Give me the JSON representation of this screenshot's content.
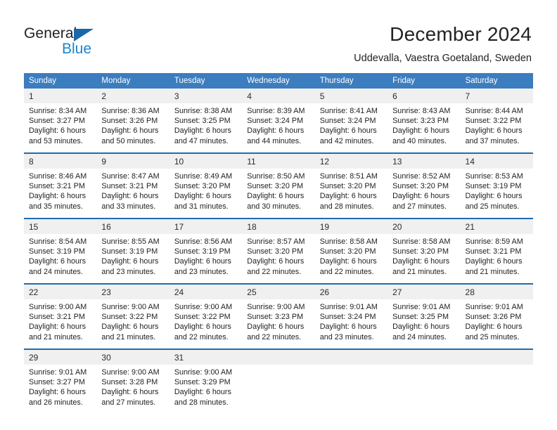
{
  "brand": {
    "name_part1": "General",
    "name_part2": "Blue",
    "triangle_color": "#1769ac",
    "blue_color": "#1b85d0"
  },
  "header": {
    "title": "December 2024",
    "subtitle": "Uddevalla, Vaestra Goetaland, Sweden",
    "header_bg": "#3b7dbf",
    "separator_color": "#1f6cb0",
    "daynum_bg": "#f0f0f0"
  },
  "weekday_headers": [
    "Sunday",
    "Monday",
    "Tuesday",
    "Wednesday",
    "Thursday",
    "Friday",
    "Saturday"
  ],
  "weeks": [
    {
      "days": [
        {
          "num": "1",
          "sunrise": "Sunrise: 8:34 AM",
          "sunset": "Sunset: 3:27 PM",
          "daylight1": "Daylight: 6 hours",
          "daylight2": "and 53 minutes."
        },
        {
          "num": "2",
          "sunrise": "Sunrise: 8:36 AM",
          "sunset": "Sunset: 3:26 PM",
          "daylight1": "Daylight: 6 hours",
          "daylight2": "and 50 minutes."
        },
        {
          "num": "3",
          "sunrise": "Sunrise: 8:38 AM",
          "sunset": "Sunset: 3:25 PM",
          "daylight1": "Daylight: 6 hours",
          "daylight2": "and 47 minutes."
        },
        {
          "num": "4",
          "sunrise": "Sunrise: 8:39 AM",
          "sunset": "Sunset: 3:24 PM",
          "daylight1": "Daylight: 6 hours",
          "daylight2": "and 44 minutes."
        },
        {
          "num": "5",
          "sunrise": "Sunrise: 8:41 AM",
          "sunset": "Sunset: 3:24 PM",
          "daylight1": "Daylight: 6 hours",
          "daylight2": "and 42 minutes."
        },
        {
          "num": "6",
          "sunrise": "Sunrise: 8:43 AM",
          "sunset": "Sunset: 3:23 PM",
          "daylight1": "Daylight: 6 hours",
          "daylight2": "and 40 minutes."
        },
        {
          "num": "7",
          "sunrise": "Sunrise: 8:44 AM",
          "sunset": "Sunset: 3:22 PM",
          "daylight1": "Daylight: 6 hours",
          "daylight2": "and 37 minutes."
        }
      ]
    },
    {
      "days": [
        {
          "num": "8",
          "sunrise": "Sunrise: 8:46 AM",
          "sunset": "Sunset: 3:21 PM",
          "daylight1": "Daylight: 6 hours",
          "daylight2": "and 35 minutes."
        },
        {
          "num": "9",
          "sunrise": "Sunrise: 8:47 AM",
          "sunset": "Sunset: 3:21 PM",
          "daylight1": "Daylight: 6 hours",
          "daylight2": "and 33 minutes."
        },
        {
          "num": "10",
          "sunrise": "Sunrise: 8:49 AM",
          "sunset": "Sunset: 3:20 PM",
          "daylight1": "Daylight: 6 hours",
          "daylight2": "and 31 minutes."
        },
        {
          "num": "11",
          "sunrise": "Sunrise: 8:50 AM",
          "sunset": "Sunset: 3:20 PM",
          "daylight1": "Daylight: 6 hours",
          "daylight2": "and 30 minutes."
        },
        {
          "num": "12",
          "sunrise": "Sunrise: 8:51 AM",
          "sunset": "Sunset: 3:20 PM",
          "daylight1": "Daylight: 6 hours",
          "daylight2": "and 28 minutes."
        },
        {
          "num": "13",
          "sunrise": "Sunrise: 8:52 AM",
          "sunset": "Sunset: 3:20 PM",
          "daylight1": "Daylight: 6 hours",
          "daylight2": "and 27 minutes."
        },
        {
          "num": "14",
          "sunrise": "Sunrise: 8:53 AM",
          "sunset": "Sunset: 3:19 PM",
          "daylight1": "Daylight: 6 hours",
          "daylight2": "and 25 minutes."
        }
      ]
    },
    {
      "days": [
        {
          "num": "15",
          "sunrise": "Sunrise: 8:54 AM",
          "sunset": "Sunset: 3:19 PM",
          "daylight1": "Daylight: 6 hours",
          "daylight2": "and 24 minutes."
        },
        {
          "num": "16",
          "sunrise": "Sunrise: 8:55 AM",
          "sunset": "Sunset: 3:19 PM",
          "daylight1": "Daylight: 6 hours",
          "daylight2": "and 23 minutes."
        },
        {
          "num": "17",
          "sunrise": "Sunrise: 8:56 AM",
          "sunset": "Sunset: 3:19 PM",
          "daylight1": "Daylight: 6 hours",
          "daylight2": "and 23 minutes."
        },
        {
          "num": "18",
          "sunrise": "Sunrise: 8:57 AM",
          "sunset": "Sunset: 3:20 PM",
          "daylight1": "Daylight: 6 hours",
          "daylight2": "and 22 minutes."
        },
        {
          "num": "19",
          "sunrise": "Sunrise: 8:58 AM",
          "sunset": "Sunset: 3:20 PM",
          "daylight1": "Daylight: 6 hours",
          "daylight2": "and 22 minutes."
        },
        {
          "num": "20",
          "sunrise": "Sunrise: 8:58 AM",
          "sunset": "Sunset: 3:20 PM",
          "daylight1": "Daylight: 6 hours",
          "daylight2": "and 21 minutes."
        },
        {
          "num": "21",
          "sunrise": "Sunrise: 8:59 AM",
          "sunset": "Sunset: 3:21 PM",
          "daylight1": "Daylight: 6 hours",
          "daylight2": "and 21 minutes."
        }
      ]
    },
    {
      "days": [
        {
          "num": "22",
          "sunrise": "Sunrise: 9:00 AM",
          "sunset": "Sunset: 3:21 PM",
          "daylight1": "Daylight: 6 hours",
          "daylight2": "and 21 minutes."
        },
        {
          "num": "23",
          "sunrise": "Sunrise: 9:00 AM",
          "sunset": "Sunset: 3:22 PM",
          "daylight1": "Daylight: 6 hours",
          "daylight2": "and 21 minutes."
        },
        {
          "num": "24",
          "sunrise": "Sunrise: 9:00 AM",
          "sunset": "Sunset: 3:22 PM",
          "daylight1": "Daylight: 6 hours",
          "daylight2": "and 22 minutes."
        },
        {
          "num": "25",
          "sunrise": "Sunrise: 9:00 AM",
          "sunset": "Sunset: 3:23 PM",
          "daylight1": "Daylight: 6 hours",
          "daylight2": "and 22 minutes."
        },
        {
          "num": "26",
          "sunrise": "Sunrise: 9:01 AM",
          "sunset": "Sunset: 3:24 PM",
          "daylight1": "Daylight: 6 hours",
          "daylight2": "and 23 minutes."
        },
        {
          "num": "27",
          "sunrise": "Sunrise: 9:01 AM",
          "sunset": "Sunset: 3:25 PM",
          "daylight1": "Daylight: 6 hours",
          "daylight2": "and 24 minutes."
        },
        {
          "num": "28",
          "sunrise": "Sunrise: 9:01 AM",
          "sunset": "Sunset: 3:26 PM",
          "daylight1": "Daylight: 6 hours",
          "daylight2": "and 25 minutes."
        }
      ]
    },
    {
      "days": [
        {
          "num": "29",
          "sunrise": "Sunrise: 9:01 AM",
          "sunset": "Sunset: 3:27 PM",
          "daylight1": "Daylight: 6 hours",
          "daylight2": "and 26 minutes."
        },
        {
          "num": "30",
          "sunrise": "Sunrise: 9:00 AM",
          "sunset": "Sunset: 3:28 PM",
          "daylight1": "Daylight: 6 hours",
          "daylight2": "and 27 minutes."
        },
        {
          "num": "31",
          "sunrise": "Sunrise: 9:00 AM",
          "sunset": "Sunset: 3:29 PM",
          "daylight1": "Daylight: 6 hours",
          "daylight2": "and 28 minutes."
        },
        {
          "num": "",
          "sunrise": "",
          "sunset": "",
          "daylight1": "",
          "daylight2": ""
        },
        {
          "num": "",
          "sunrise": "",
          "sunset": "",
          "daylight1": "",
          "daylight2": ""
        },
        {
          "num": "",
          "sunrise": "",
          "sunset": "",
          "daylight1": "",
          "daylight2": ""
        },
        {
          "num": "",
          "sunrise": "",
          "sunset": "",
          "daylight1": "",
          "daylight2": ""
        }
      ]
    }
  ]
}
